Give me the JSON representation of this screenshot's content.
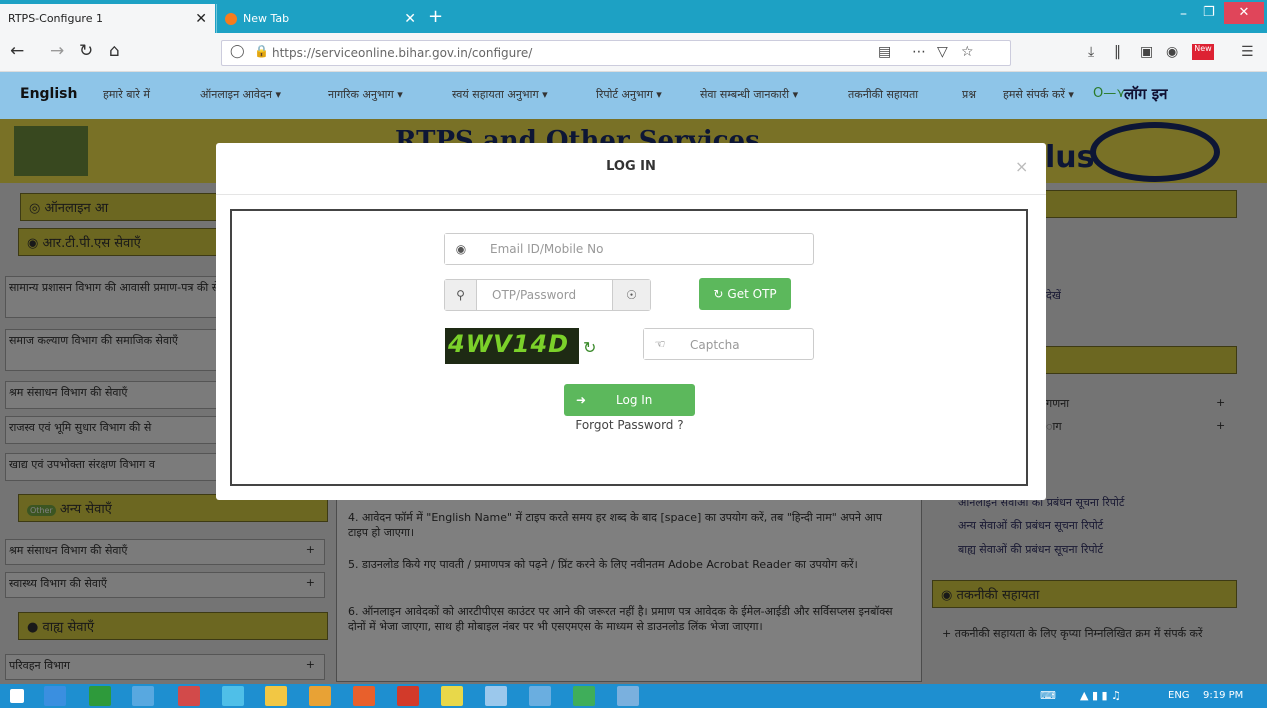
{
  "browser": {
    "tabs": [
      {
        "label": "RTPS-Configure 1",
        "close": "✕"
      },
      {
        "label": "New Tab",
        "close": "✕"
      }
    ],
    "new_tab_symbol": "+",
    "url": "https://serviceonline.bihar.gov.in/configure/",
    "nav_icons": [
      "back-arrow-icon",
      "forward-arrow-icon",
      "reload-icon",
      "home-icon"
    ],
    "toolbar_icons": [
      "reader-view-icon",
      "more-actions-icon",
      "pocket-icon",
      "bookmark-star-icon",
      "download-icon",
      "library-icon",
      "sidebar-icon",
      "extension-icon",
      "new-icon",
      "menu-icon"
    ]
  },
  "site_menu": {
    "english": "English",
    "items": [
      "हमारे बारे में",
      "ऑनलाइन आवेदन ▾",
      "नागरिक अनुभाग ▾",
      "स्वयं सहायता अनुभाग ▾",
      "रिपोर्ट अनुभाग ▾",
      "सेवा सम्बन्धी जानकारी ▾",
      "तकनीकी सहायता",
      "प्रश्न",
      "हमसे संपर्क करें ▾"
    ],
    "login": "लॉग इन"
  },
  "banner": {
    "title": "RTPS and Other Services",
    "right_fragment": "lus"
  },
  "left_panel": {
    "online_heading": "ऑनलाइन आ",
    "rtps_heading": "आर.टी.पी.एस सेवाएँ",
    "rtps_items": [
      "सामान्य प्रशासन विभाग की आवासी प्रमाण-पत्र की सेवाएँ",
      "समाज कल्याण विभाग की समाजिक सेवाएँ",
      "श्रम संसाधन विभाग की सेवाएँ",
      "राजस्व एवं भूमि सुधार विभाग की से",
      "खाद्य एवं उपभोक्ता संरक्षण विभाग व"
    ],
    "other_heading": "अन्य सेवाएँ",
    "other_items": [
      "श्रम संसाधन विभाग की सेवाएँ",
      "स्वास्थ्य विभाग की सेवाएँ"
    ],
    "external_heading": "वाह्य सेवाएँ",
    "external_items": [
      "परिवहन विभाग"
    ],
    "plus": "+"
  },
  "middle_panel": {
    "points": [
      "4. आवेदन फॉर्म में \"English Name\" में टाइप करते समय हर शब्द के बाद [space] का उपयोग करें, तब \"हिन्दी नाम\" अपने आप टाइप हो जाएगा।",
      "5. डाउनलोड किये गए पावती / प्रमाणपत्र को पढ़ने / प्रिंट करने के लिए नवीनतम Adobe Acrobat Reader का उपयोग करें।",
      "6. ऑनलाइन आवेदकों को आरटीपीएस काउंटर पर आने की जरूरत नहीं है। प्रमाण पत्र आवेदक के ईमेल-आईडी और सर्विसप्लस इनबॉक्स दोनों में भेजा जाएगा, साथ ही मोबाइल नंबर पर भी एसएमएस के माध्यम से डाउनलोड लिंक भेजा जाएगा।"
    ]
  },
  "right_panel": {
    "heading1": "नुभाग",
    "link1": "देखें",
    "heading2": "भाग",
    "items2": [
      "गणना",
      "ाग"
    ],
    "plus": "+",
    "report_links": [
      "ऑनलाइन सेवाओं की प्रबंधन सूचना रिपोर्ट",
      "अन्य सेवाओं की प्रबंधन सूचना रिपोर्ट",
      "बाह्य सेवाओं की प्रबंधन सूचना रिपोर्ट"
    ],
    "tech_heading": "तकनीकी सहायता",
    "tech_text": "+ तकनीकी सहायता के लिए कृप्या निम्नलिखित क्रम में संपर्क करें"
  },
  "modal": {
    "title": "LOG IN",
    "close": "×",
    "email_placeholder": "Email ID/Mobile No",
    "password_placeholder": "OTP/Password",
    "get_otp": "Get OTP",
    "captcha_text": "4WV14D",
    "captcha_placeholder": "Captcha",
    "login_button": "Log In",
    "forgot": "Forgot Password ?"
  },
  "taskbar": {
    "language": "ENG",
    "time": "9:19 PM"
  },
  "colors": {
    "tab_bar": "#1da1c4",
    "site_menu": "#8ec5e8",
    "banner": "#f2e34c",
    "success_button": "#5cb85c",
    "taskbar": "#1e8fd0",
    "window_close": "#e0455a"
  }
}
